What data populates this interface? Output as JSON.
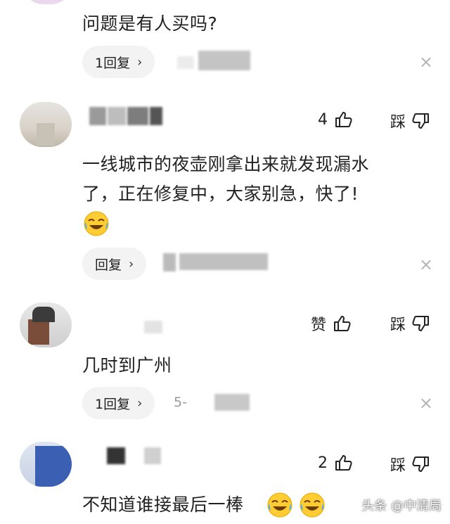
{
  "comments": [
    {
      "text": "问题是有人买吗?",
      "reply_label": "1回复",
      "like_count": "",
      "like_label": "",
      "dislike_label": ""
    },
    {
      "text_line1": "一线城市的夜壶刚拿出来就发现漏水",
      "text_line2": "了，正在修复中，大家别急，快了!",
      "reply_label": "回复",
      "like_count": "4",
      "dislike_label": "踩"
    },
    {
      "text": "几时到广州",
      "reply_label": "1回复",
      "date_partial": "5-",
      "like_label": "赞",
      "dislike_label": "踩"
    },
    {
      "text": "不知道谁接最后一棒",
      "like_count": "2",
      "dislike_label": "踩"
    }
  ],
  "ui": {
    "chevron": "›",
    "close_glyph": "×"
  },
  "watermark": "头条 @中清局",
  "icons": {
    "thumb_up": "thumbs-up-icon",
    "thumb_down": "thumbs-down-icon",
    "close": "close-icon",
    "emoji": "tears-of-joy-emoji"
  }
}
